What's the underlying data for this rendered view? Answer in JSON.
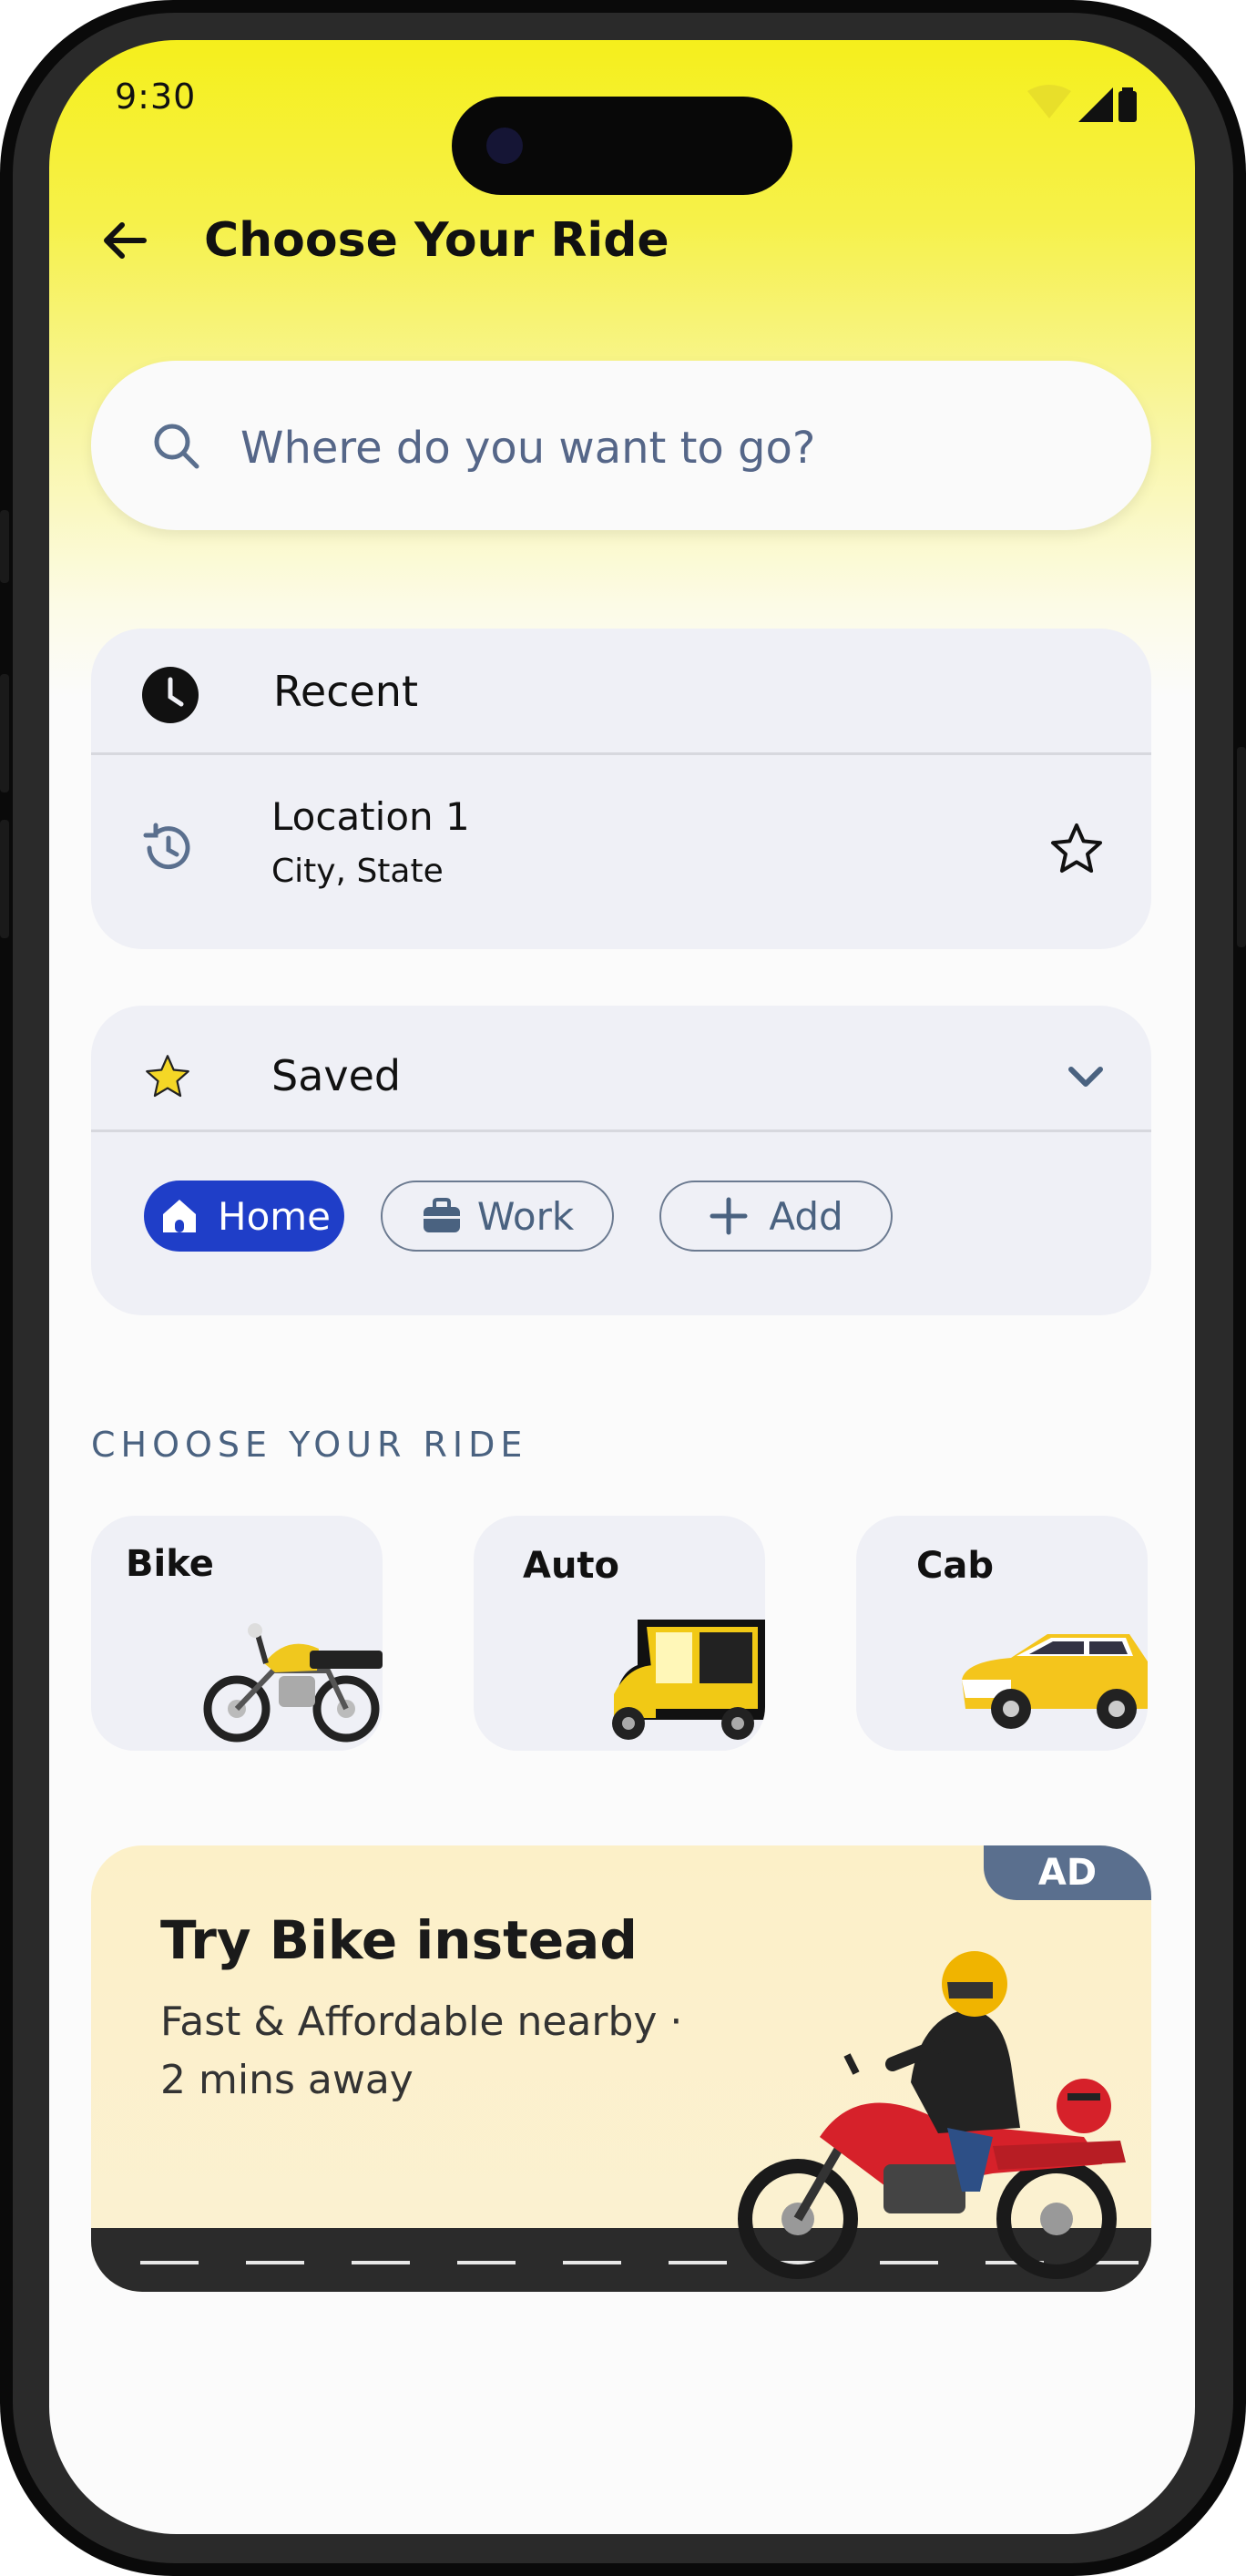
{
  "status": {
    "time": "9:30"
  },
  "header": {
    "title": "Choose Your Ride"
  },
  "search": {
    "placeholder": "Where do you want to go?"
  },
  "recent": {
    "heading": "Recent",
    "item": {
      "name": "Location 1",
      "sub": "City, State"
    }
  },
  "saved": {
    "heading": "Saved",
    "chips": {
      "home": "Home",
      "work": "Work",
      "add": "Add"
    }
  },
  "rides": {
    "section_title": "CHOOSE YOUR RIDE",
    "options": [
      "Bike",
      "Auto",
      "Cab"
    ]
  },
  "ad": {
    "badge": "AD",
    "title": "Try Bike instead",
    "line1": "Fast & Affordable nearby ·",
    "line2": "2 mins away"
  },
  "colors": {
    "accent": "#1f3ec8",
    "yellow": "#f5ef1c",
    "card": "#eff0f6"
  }
}
